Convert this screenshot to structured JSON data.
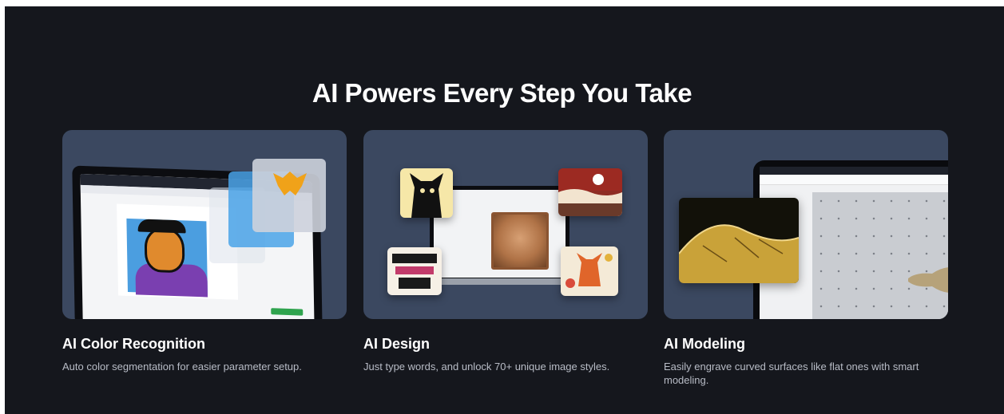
{
  "section": {
    "title": "AI Powers Every Step You Take"
  },
  "cards": [
    {
      "title": "AI Color Recognition",
      "description": "Auto color segmentation for easier parameter setup.",
      "image_alt": "Laptop showing color segmentation of a tiger illustration"
    },
    {
      "title": "AI Design",
      "description": "Just type words, and unlock 70+ unique image styles.",
      "image_alt": "Laptop surrounded by AI-generated image style samples"
    },
    {
      "title": "AI Modeling",
      "description": "Easily engrave curved surfaces like flat ones with smart modeling.",
      "image_alt": "Tablet showing curved surface engraving"
    }
  ],
  "colors": {
    "page_bg": "#15171d",
    "card_bg": "#3b4860",
    "title": "#ffffff",
    "desc": "#b8bcc6"
  }
}
